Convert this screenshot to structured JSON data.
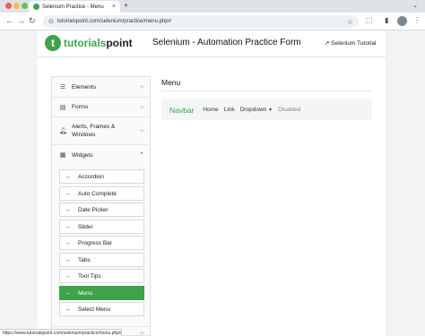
{
  "browser": {
    "tab_title": "Selenium Practice - Menu",
    "tab_close": "×",
    "new_tab": "+",
    "url": "tutorialspoint.com/selenium/practice/menu.php#",
    "status_url": "https://www.tutorialspoint.com/selenium/practice/menu.php#",
    "colors": {
      "close": "#ee5f57",
      "minimize": "#f5bd4f",
      "maximize": "#5fc454"
    }
  },
  "header": {
    "logo_letter": "t",
    "logo_brand": "tutorials",
    "logo_suffix": "point",
    "title": "Selenium - Automation Practice Form",
    "tutorial_link": "Selenium Tutorial"
  },
  "sidebar": {
    "sections": [
      {
        "label": "Elements",
        "icon": "hamburger-icon"
      },
      {
        "label": "Forms",
        "icon": "form-icon"
      },
      {
        "label": "Alerts, Frames & Windows",
        "icon": "bell-icon"
      },
      {
        "label": "Widgets",
        "icon": "grid-icon"
      }
    ],
    "widgets": [
      "Accordion",
      "Auto Complete",
      "Date Picker",
      "Slider",
      "Progress Bar",
      "Tabs",
      "Tool Tips",
      "Menu",
      "Select Menu"
    ],
    "active_widget": "Menu"
  },
  "main": {
    "heading": "Menu",
    "navbar": {
      "brand": "Navbar",
      "links": [
        "Home",
        "Link"
      ],
      "dropdown": "Dropdown",
      "disabled": "Disabled"
    }
  },
  "accent_color": "#3ea34b"
}
